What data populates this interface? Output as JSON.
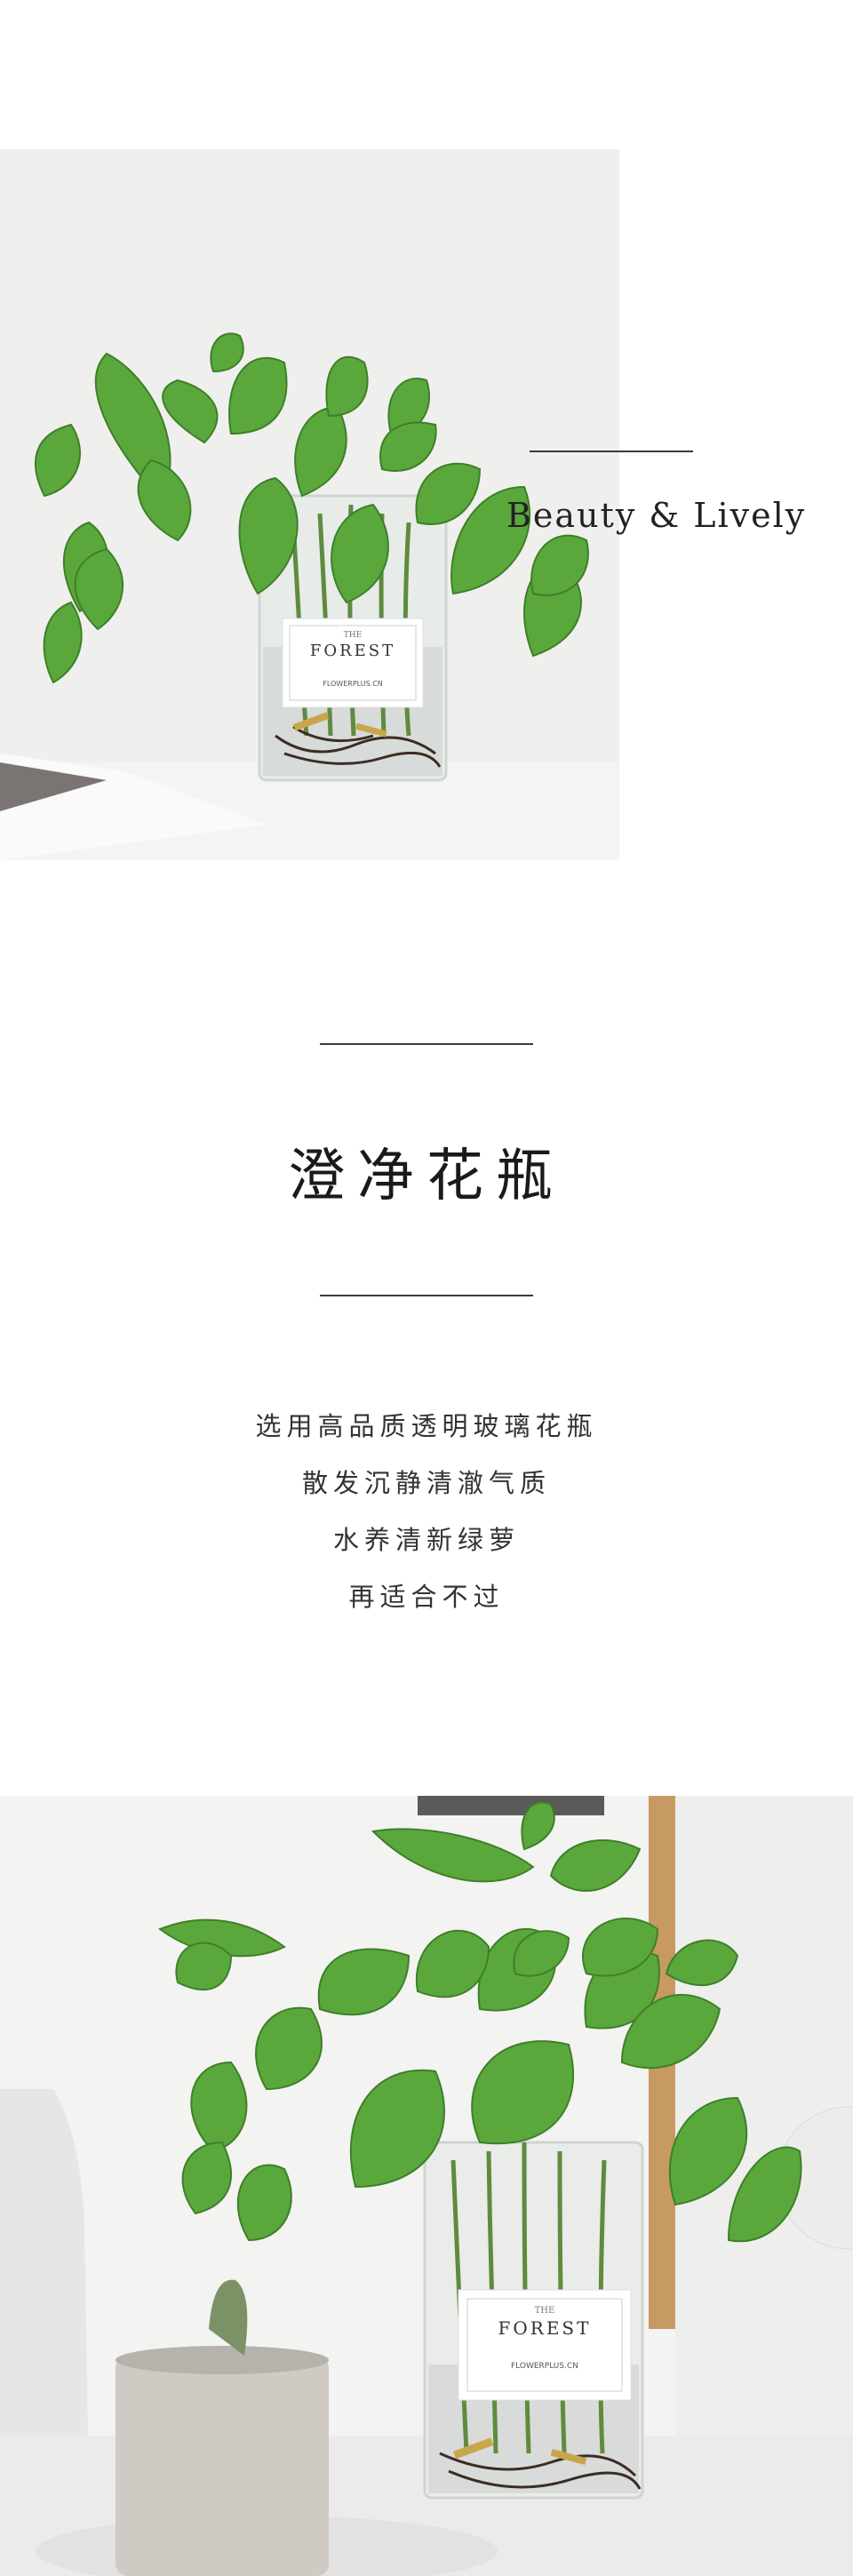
{
  "hero": {
    "caption": "Beauty & Lively",
    "vase_label_small": "THE",
    "vase_label_brand": "FOREST",
    "vase_label_sub": "FLOWERPLUS.CN"
  },
  "section": {
    "title": "澄净花瓶",
    "lines": [
      "选用高品质透明玻璃花瓶",
      "散发沉静清澈气质",
      "水养清新绿萝",
      "再适合不过"
    ]
  },
  "photo2": {
    "vase_label_small": "THE",
    "vase_label_brand": "FOREST",
    "vase_label_sub": "FLOWERPLUS.CN"
  }
}
